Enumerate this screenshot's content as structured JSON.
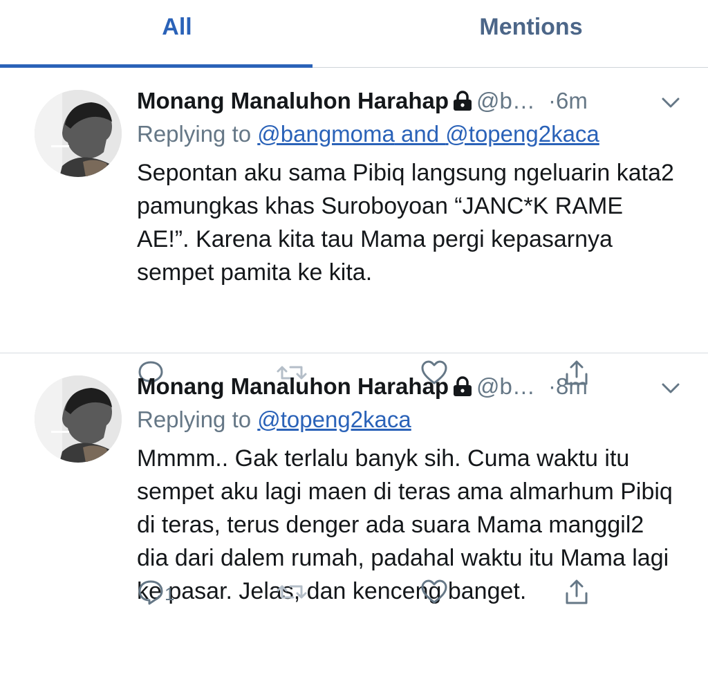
{
  "tabs": [
    {
      "label": "All"
    },
    {
      "label": "Mentions"
    }
  ],
  "tweets": [
    {
      "name": "Monang Manaluhon Harahap",
      "handle": "@b…",
      "separator": "·",
      "time": "6m",
      "replying_prefix": "Replying to ",
      "mentions": [
        "@bangmoma",
        "@topeng2kaca"
      ],
      "mention_joiner": " and ",
      "text": "Sepontan aku sama Pibiq langsung ngeluarin kata2 pamungkas khas Suroboyoan “JANC*K RAME AE!”. Karena kita tau Mama pergi kepasarnya sempet pamita ke kita.",
      "reply_count": ""
    },
    {
      "name": "Monang Manaluhon Harahap",
      "handle": "@b…",
      "separator": "·",
      "time": "8m",
      "replying_prefix": "Replying to ",
      "mentions": [
        "@topeng2kaca"
      ],
      "mention_joiner": "",
      "text": "Mmmm.. Gak terlalu banyk sih. Cuma waktu itu sempet aku lagi maen di teras ama almarhum Pibiq di teras, terus denger ada suara Mama manggil2 dia dari dalem rumah, padahal waktu itu Mama lagi ke pasar. Jelas, dan kenceng banget.",
      "reply_count": "1"
    }
  ],
  "icons": {
    "lock": "lock-icon",
    "chevron": "chevron-down-icon",
    "reply": "reply-icon",
    "retweet": "retweet-icon",
    "like": "heart-icon",
    "share": "share-icon"
  },
  "colors": {
    "accent": "#2a62b8",
    "secondary_text": "#657786",
    "primary_text": "#14171a"
  }
}
